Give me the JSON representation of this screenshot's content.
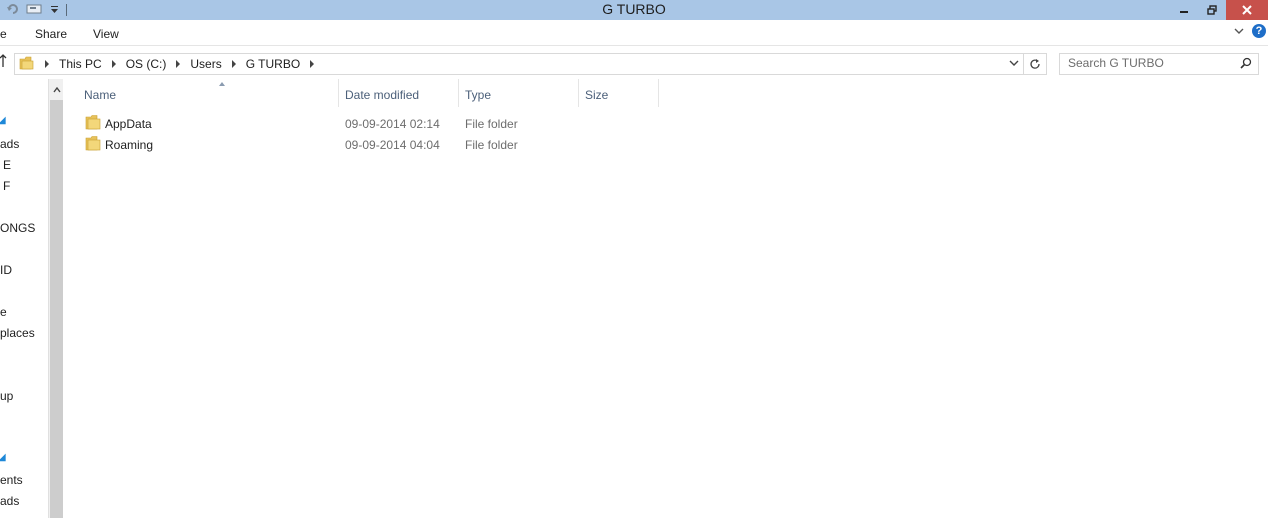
{
  "window": {
    "title": "G TURBO"
  },
  "ribbon": {
    "tabs": [
      "e",
      "Share",
      "View"
    ]
  },
  "address": {
    "crumbs": [
      "This PC",
      "OS (C:)",
      "Users",
      "G TURBO"
    ]
  },
  "search": {
    "placeholder": "Search G TURBO"
  },
  "nav": {
    "items": [
      "ads",
      "E",
      "F",
      "ONGS",
      "ID",
      "e",
      "places",
      "up",
      "ents",
      "ads"
    ]
  },
  "columns": {
    "name": "Name",
    "date": "Date modified",
    "type": "Type",
    "size": "Size"
  },
  "files": [
    {
      "name": "AppData",
      "date": "09-09-2014 02:14",
      "type": "File folder",
      "size": ""
    },
    {
      "name": "Roaming",
      "date": "09-09-2014 04:04",
      "type": "File folder",
      "size": ""
    }
  ],
  "colors": {
    "titlebar": "#a9c6e6",
    "close": "#c7514b",
    "folder": "#e8c25a",
    "accent": "#1e88d8"
  },
  "icons": [
    "folder-icon",
    "search-icon",
    "refresh-icon",
    "help-icon",
    "minimize-icon",
    "restore-icon",
    "close-icon"
  ]
}
